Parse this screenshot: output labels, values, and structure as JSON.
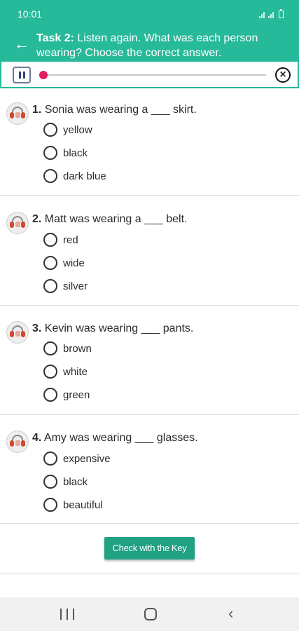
{
  "status_bar": {
    "time": "10:01"
  },
  "header": {
    "task_label": "Task 2:",
    "instruction": "Listen again. What was each person wearing? Choose the correct answer.",
    "back_icon": "arrow-left-icon",
    "background": "#26b99a"
  },
  "player": {
    "pause_icon": "pause-icon",
    "close_icon": "close-circle-icon",
    "progress": 0.0,
    "thumb_color": "#e21d5f"
  },
  "questions": [
    {
      "number": "1.",
      "text": "Sonia was wearing a ___ skirt.",
      "options": [
        "yellow",
        "black",
        "dark blue"
      ]
    },
    {
      "number": "2.",
      "text": "Matt was wearing a ___ belt.",
      "options": [
        "red",
        "wide",
        "silver"
      ]
    },
    {
      "number": "3.",
      "text": "Kevin was wearing ___ pants.",
      "options": [
        "brown",
        "white",
        "green"
      ]
    },
    {
      "number": "4.",
      "text": "Amy was wearing ___ glasses.",
      "options": [
        "expensive",
        "black",
        "beautiful"
      ]
    }
  ],
  "check_button": {
    "label": "Check with the Key",
    "color": "#1fa182"
  },
  "nav_bar": {
    "recent_icon": "recent-apps-icon",
    "home_icon": "home-icon",
    "back_icon": "chevron-left-icon"
  }
}
